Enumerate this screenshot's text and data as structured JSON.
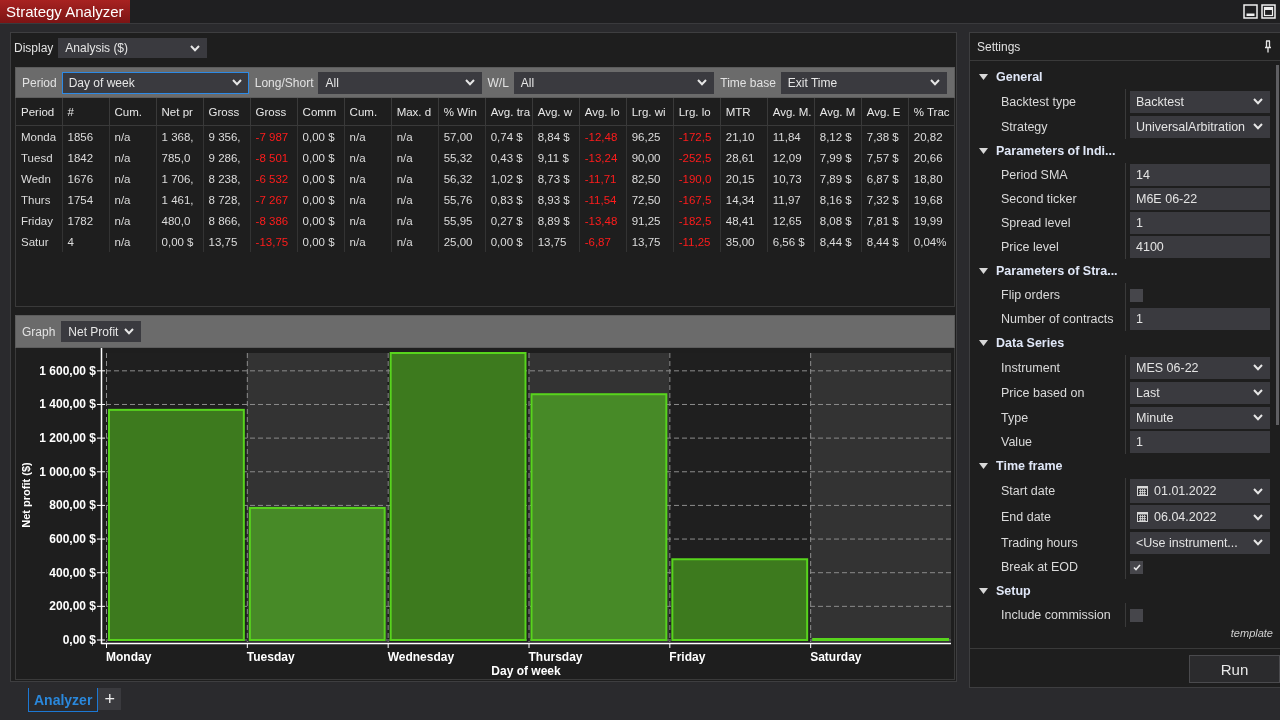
{
  "window": {
    "title": "Strategy Analyzer"
  },
  "display": {
    "label": "Display",
    "value": "Analysis ($)"
  },
  "filters": [
    {
      "label": "Period",
      "value": "Day of week",
      "focused": true
    },
    {
      "label": "Long/Short",
      "value": "All",
      "focused": false
    },
    {
      "label": "W/L",
      "value": "All",
      "focused": false
    },
    {
      "label": "Time base",
      "value": "Exit Time",
      "focused": false
    }
  ],
  "table": {
    "columns": [
      {
        "label": "Period",
        "negative": false
      },
      {
        "label": "#",
        "negative": false
      },
      {
        "label": "Cum.",
        "negative": false
      },
      {
        "label": "Net pr",
        "negative": false
      },
      {
        "label": "Gross",
        "negative": false
      },
      {
        "label": "Gross",
        "negative": true
      },
      {
        "label": "Comm",
        "negative": false
      },
      {
        "label": "Cum.",
        "negative": false
      },
      {
        "label": "Max. d",
        "negative": false
      },
      {
        "label": "% Win",
        "negative": false
      },
      {
        "label": "Avg. tra",
        "negative": false
      },
      {
        "label": "Avg. w",
        "negative": false
      },
      {
        "label": "Avg. lo",
        "negative": true
      },
      {
        "label": "Lrg. wi",
        "negative": false
      },
      {
        "label": "Lrg. lo",
        "negative": true
      },
      {
        "label": "MTR",
        "negative": false
      },
      {
        "label": "Avg. M.",
        "negative": false
      },
      {
        "label": "Avg. M",
        "negative": false
      },
      {
        "label": "Avg. E",
        "negative": false
      },
      {
        "label": "% Trac",
        "negative": false
      }
    ],
    "rows": [
      [
        "Monda",
        "1856",
        "n/a",
        "1 368,",
        "9 356,",
        "-7 987",
        "0,00 $",
        "n/a",
        "n/a",
        "57,00",
        "0,74 $",
        "8,84 $",
        "-12,48",
        "96,25",
        "-172,5",
        "21,10",
        "11,84",
        "8,12 $",
        "7,38 $",
        "20,82"
      ],
      [
        "Tuesd",
        "1842",
        "n/a",
        "785,0",
        "9 286,",
        "-8 501",
        "0,00 $",
        "n/a",
        "n/a",
        "55,32",
        "0,43 $",
        "9,11 $",
        "-13,24",
        "90,00",
        "-252,5",
        "28,61",
        "12,09",
        "7,99 $",
        "7,57 $",
        "20,66"
      ],
      [
        "Wedn",
        "1676",
        "n/a",
        "1 706,",
        "8 238,",
        "-6 532",
        "0,00 $",
        "n/a",
        "n/a",
        "56,32",
        "1,02 $",
        "8,73 $",
        "-11,71",
        "82,50",
        "-190,0",
        "20,15",
        "10,73",
        "7,89 $",
        "6,87 $",
        "18,80"
      ],
      [
        "Thurs",
        "1754",
        "n/a",
        "1 461,",
        "8 728,",
        "-7 267",
        "0,00 $",
        "n/a",
        "n/a",
        "55,76",
        "0,83 $",
        "8,93 $",
        "-11,54",
        "72,50",
        "-167,5",
        "14,34",
        "11,97",
        "8,16 $",
        "7,32 $",
        "19,68"
      ],
      [
        "Friday",
        "1782",
        "n/a",
        "480,0",
        "8 866,",
        "-8 386",
        "0,00 $",
        "n/a",
        "n/a",
        "55,95",
        "0,27 $",
        "8,89 $",
        "-13,48",
        "91,25",
        "-182,5",
        "48,41",
        "12,65",
        "8,08 $",
        "7,81 $",
        "19,99"
      ],
      [
        "Satur",
        "4",
        "n/a",
        "0,00 $",
        "13,75",
        "-13,75",
        "0,00 $",
        "n/a",
        "n/a",
        "25,00",
        "0,00 $",
        "13,75",
        "-6,87",
        "13,75",
        "-11,25",
        "35,00",
        "6,56 $",
        "8,44 $",
        "8,44 $",
        "0,04%"
      ]
    ]
  },
  "graph": {
    "label": "Graph",
    "value": "Net Profit",
    "chart_data": {
      "type": "bar",
      "xlabel": "Day of week",
      "ylabel": "Net profit ($)",
      "categories": [
        "Monday",
        "Tuesday",
        "Wednesday",
        "Thursday",
        "Friday",
        "Saturday"
      ],
      "values": [
        1368,
        785,
        1706,
        1461,
        480,
        0
      ],
      "ylim": [
        0,
        1706
      ],
      "grid": true,
      "yticks": [
        {
          "value": 0,
          "label": "0,00 $"
        },
        {
          "value": 200,
          "label": "200,00 $"
        },
        {
          "value": 400,
          "label": "400,00 $"
        },
        {
          "value": 600,
          "label": "600,00 $"
        },
        {
          "value": 800,
          "label": "800,00 $"
        },
        {
          "value": 1000,
          "label": "1 000,00 $"
        },
        {
          "value": 1200,
          "label": "1 200,00 $"
        },
        {
          "value": 1400,
          "label": "1 400,00 $"
        },
        {
          "value": 1600,
          "label": "1 600,00 $"
        }
      ]
    }
  },
  "settings": {
    "title": "Settings",
    "groups": [
      {
        "title": "General",
        "expanded": true,
        "items": [
          {
            "label": "Backtest type",
            "kind": "dropdown",
            "value": "Backtest"
          },
          {
            "label": "Strategy",
            "kind": "dropdown",
            "value": "UniversalArbitration"
          }
        ]
      },
      {
        "title": "Parameters of Indi...",
        "expanded": true,
        "items": [
          {
            "label": "Period SMA",
            "kind": "text",
            "value": "14"
          },
          {
            "label": "Second ticker",
            "kind": "text",
            "value": "M6E 06-22"
          },
          {
            "label": "Spread level",
            "kind": "text",
            "value": "1"
          },
          {
            "label": "Price level",
            "kind": "text",
            "value": "4100"
          }
        ]
      },
      {
        "title": "Parameters of Stra...",
        "expanded": true,
        "items": [
          {
            "label": "Flip orders",
            "kind": "checkbox",
            "checked": false
          },
          {
            "label": "Number of contracts",
            "kind": "text",
            "value": "1"
          }
        ]
      },
      {
        "title": "Data Series",
        "expanded": true,
        "items": [
          {
            "label": "Instrument",
            "kind": "dropdown",
            "value": "MES 06-22"
          },
          {
            "label": "Price based on",
            "kind": "dropdown",
            "value": "Last"
          },
          {
            "label": "Type",
            "kind": "dropdown",
            "value": "Minute"
          },
          {
            "label": "Value",
            "kind": "text",
            "value": "1"
          }
        ]
      },
      {
        "title": "Time frame",
        "expanded": true,
        "items": [
          {
            "label": "Start date",
            "kind": "date",
            "value": "01.01.2022"
          },
          {
            "label": "End date",
            "kind": "date",
            "value": "06.04.2022"
          },
          {
            "label": "Trading hours",
            "kind": "dropdown",
            "value": "<Use instrument..."
          },
          {
            "label": "Break at EOD",
            "kind": "checkbox",
            "checked": true
          }
        ]
      },
      {
        "title": "Setup",
        "expanded": true,
        "items": [
          {
            "label": "Include commission",
            "kind": "checkbox",
            "checked": false
          }
        ]
      }
    ],
    "template": "template",
    "run": "Run"
  },
  "tabs": [
    {
      "label": "Analyzer",
      "selected": true
    }
  ],
  "add_tab": "+"
}
